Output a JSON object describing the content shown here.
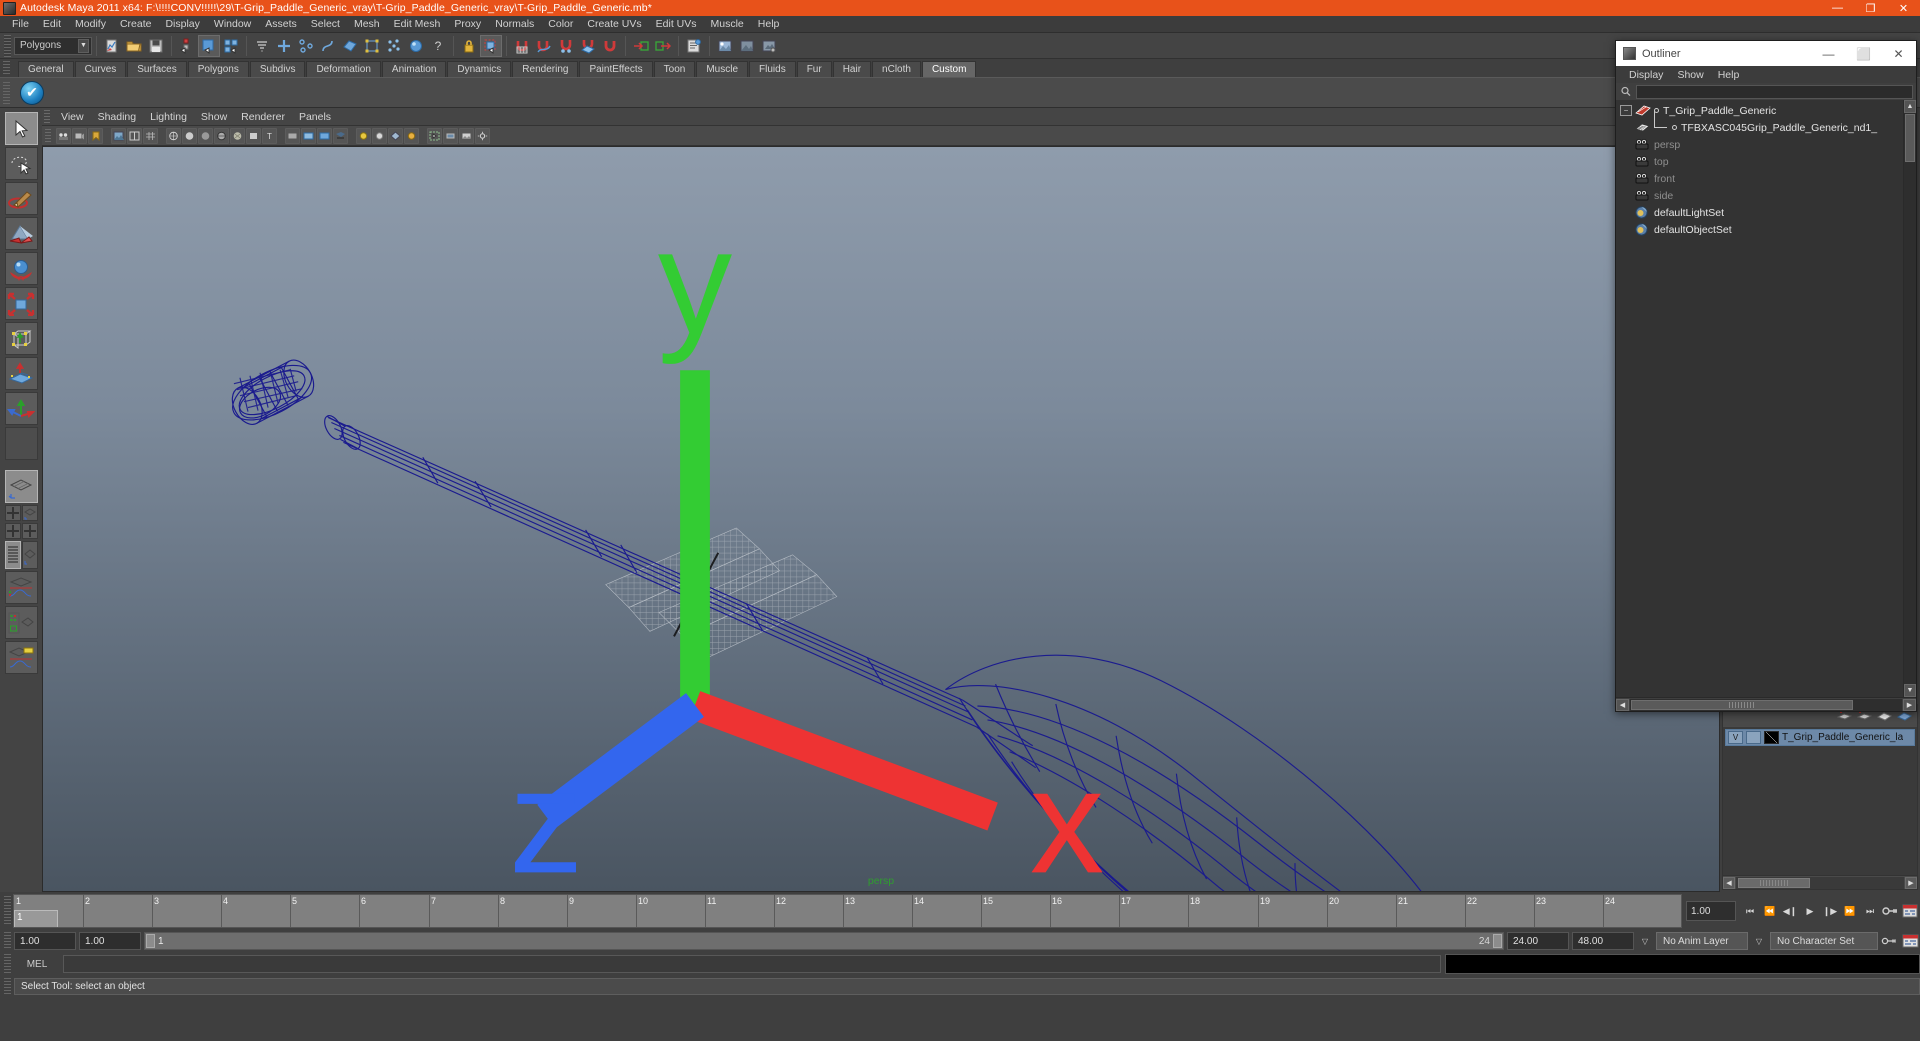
{
  "titlebar": {
    "app_title": "Autodesk Maya 2011 x64: F:\\!!!!CONV!!!!!\\29\\T-Grip_Paddle_Generic_vray\\T-Grip_Paddle_Generic_vray\\T-Grip_Paddle_Generic.mb*",
    "minimize": "—",
    "maximize": "❐",
    "close": "✕",
    "accent_color": "#e8521a"
  },
  "menubar": {
    "items": [
      "File",
      "Edit",
      "Modify",
      "Create",
      "Display",
      "Window",
      "Assets",
      "Select",
      "Mesh",
      "Edit Mesh",
      "Proxy",
      "Normals",
      "Color",
      "Create UVs",
      "Edit UVs",
      "Muscle",
      "Help"
    ]
  },
  "statusline": {
    "mode_selector": "Polygons",
    "dropdown_arrow": "▼"
  },
  "shelf": {
    "tabs": [
      "General",
      "Curves",
      "Surfaces",
      "Polygons",
      "Subdivs",
      "Deformation",
      "Animation",
      "Dynamics",
      "Rendering",
      "PaintEffects",
      "Toon",
      "Muscle",
      "Fluids",
      "Fur",
      "Hair",
      "nCloth",
      "Custom"
    ],
    "selected_tab": "Custom",
    "button_icon": "✔"
  },
  "viewport": {
    "menu": [
      "View",
      "Shading",
      "Lighting",
      "Show",
      "Renderer",
      "Panels"
    ],
    "camera_label": "persp",
    "axis": {
      "x": "x",
      "y": "y",
      "z": "z"
    },
    "wireframe_color": "#1a1a8c",
    "bg_top": "#8c9aab",
    "bg_bottom": "#4c5763"
  },
  "outliner": {
    "window_title": "Outliner",
    "minimize": "—",
    "maximize": "⬜",
    "close": "✕",
    "menu": [
      "Display",
      "Show",
      "Help"
    ],
    "search_value": "",
    "items": [
      {
        "label": "T_Grip_Paddle_Generic",
        "indent": 0,
        "dim": false,
        "icon": "transform-icon",
        "expander": "−"
      },
      {
        "label": "TFBXASC045Grip_Paddle_Generic_nd1_",
        "indent": 1,
        "dim": false,
        "icon": "mesh-icon",
        "expander": ""
      },
      {
        "label": "persp",
        "indent": 0,
        "dim": true,
        "icon": "camera-icon",
        "expander": ""
      },
      {
        "label": "top",
        "indent": 0,
        "dim": true,
        "icon": "camera-icon",
        "expander": ""
      },
      {
        "label": "front",
        "indent": 0,
        "dim": true,
        "icon": "camera-icon",
        "expander": ""
      },
      {
        "label": "side",
        "indent": 0,
        "dim": true,
        "icon": "camera-icon",
        "expander": ""
      },
      {
        "label": "defaultLightSet",
        "indent": 0,
        "dim": false,
        "icon": "set-icon",
        "expander": ""
      },
      {
        "label": "defaultObjectSet",
        "indent": 0,
        "dim": false,
        "icon": "set-icon",
        "expander": ""
      }
    ],
    "scroll_up": "▲",
    "scroll_down": "▼",
    "scroll_left": "◀",
    "scroll_right": "▶"
  },
  "layer_editor": {
    "row_visibility": "V",
    "row_playback": "",
    "layer_name": "T_Grip_Paddle_Generic_la",
    "scroll_left": "◀",
    "scroll_right": "▶"
  },
  "timeline": {
    "ticks": [
      "1",
      "2",
      "3",
      "4",
      "5",
      "6",
      "7",
      "8",
      "9",
      "10",
      "11",
      "12",
      "13",
      "14",
      "15",
      "16",
      "17",
      "18",
      "19",
      "20",
      "21",
      "22",
      "23",
      "24"
    ],
    "current_frame": "1",
    "current_frame_field": "1.00",
    "playback_buttons": [
      "⏮",
      "⏪",
      "◀❙",
      "▶",
      "❙▶",
      "⏩",
      "⏭"
    ]
  },
  "range": {
    "start": "1.00",
    "end": "1.00",
    "range_start_label": "1",
    "range_end_label": "24",
    "playback_end": "24.00",
    "anim_end": "48.00",
    "anim_layer": "No Anim Layer",
    "character_set": "No Character Set",
    "dropdown_arrow": "▽"
  },
  "command_line": {
    "language_label": "MEL",
    "input_value": "",
    "placeholder": ""
  },
  "help_line": {
    "text": "Select Tool: select an object"
  },
  "toolbox": {
    "tools": [
      "select-tool",
      "lasso-tool",
      "paint-select-tool",
      "move-tool",
      "rotate-tool",
      "scale-tool",
      "universal-manipulator",
      "soft-modification-tool",
      "last-tool-used",
      "blank-slot"
    ]
  }
}
